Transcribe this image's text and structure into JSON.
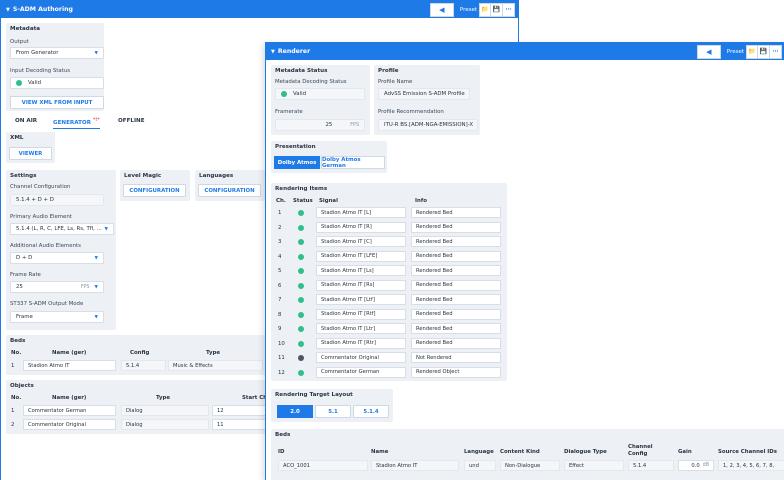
{
  "authoring": {
    "title": "S-ADM Authoring",
    "preset_label": "Preset",
    "metadata": {
      "title": "Metadata",
      "output_label": "Output",
      "output_value": "From Generator",
      "input_decoding_label": "Input Decoding Status",
      "input_decoding_value": "Valid",
      "view_xml_button": "VIEW XML FROM INPUT"
    },
    "tabs": [
      {
        "label": "ON AIR"
      },
      {
        "label": "GENERATOR",
        "marker": "*!*"
      },
      {
        "label": "OFFLINE"
      }
    ],
    "xml": {
      "title": "XML",
      "viewer_button": "VIEWER"
    },
    "settings": {
      "title": "Settings",
      "channel_config_label": "Channel Configuration",
      "channel_config_value": "5.1.4 + D + D",
      "primary_audio_label": "Primary Audio Element",
      "primary_audio_value": "5.1.4 (L, R, C, LFE, Ls, Rs, Tfl, ...",
      "additional_audio_label": "Additional Audio Elements",
      "additional_audio_value": "D + D",
      "frame_rate_label": "Frame Rate",
      "frame_rate_value": "25",
      "frame_rate_unit": "FPS",
      "output_mode_label": "ST337 S-ADM Output Mode",
      "output_mode_value": "Frame"
    },
    "level_magic": {
      "title": "Level Magic",
      "button": "CONFIGURATION"
    },
    "languages": {
      "title": "Languages",
      "button": "CONFIGURATION"
    },
    "beds": {
      "title": "Beds",
      "headers": [
        "No.",
        "Name (ger)",
        "Config",
        "Type"
      ],
      "rows": [
        {
          "no": "1",
          "name": "Stadion Atmo IT",
          "config": "5.1.4",
          "type": "Music & Effects"
        }
      ]
    },
    "objects": {
      "title": "Objects",
      "headers": [
        "No.",
        "Name (ger)",
        "Type",
        "Start Ch"
      ],
      "rows": [
        {
          "no": "1",
          "name": "Commentator German",
          "type": "Dialog",
          "start": "12"
        },
        {
          "no": "2",
          "name": "Commentator Original",
          "type": "Dialog",
          "start": "11"
        }
      ]
    }
  },
  "renderer": {
    "title": "Renderer",
    "preset_label": "Preset",
    "metadata_status": {
      "title": "Metadata Status",
      "decoding_label": "Metadata Decoding Status",
      "decoding_value": "Valid",
      "framerate_label": "Framerate",
      "framerate_value": "25",
      "framerate_unit": "FPS"
    },
    "profile": {
      "title": "Profile",
      "name_label": "Profile Name",
      "name_value": "AdvSS Emission S-ADM Profile",
      "recommendation_label": "Profile Recommendation",
      "recommendation_value": "ITU-R BS.[ADM-NGA-EMISSION]-X"
    },
    "presentation": {
      "title": "Presentation",
      "options": [
        "Dolby Atmos",
        "Dolby Atmos German"
      ],
      "selected": "Dolby Atmos"
    },
    "rendering_items": {
      "title": "Rendering Items",
      "headers": [
        "Ch.",
        "Status",
        "Signal",
        "Info"
      ],
      "rows": [
        {
          "ch": "1",
          "status": "green",
          "signal": "Stadion Atmo IT [L]",
          "info": "Rendered Bed"
        },
        {
          "ch": "2",
          "status": "green",
          "signal": "Stadion Atmo IT [R]",
          "info": "Rendered Bed"
        },
        {
          "ch": "3",
          "status": "green",
          "signal": "Stadion Atmo IT [C]",
          "info": "Rendered Bed"
        },
        {
          "ch": "4",
          "status": "green",
          "signal": "Stadion Atmo IT [LFE]",
          "info": "Rendered Bed"
        },
        {
          "ch": "5",
          "status": "green",
          "signal": "Stadion Atmo IT [Ls]",
          "info": "Rendered Bed"
        },
        {
          "ch": "6",
          "status": "green",
          "signal": "Stadion Atmo IT [Rs]",
          "info": "Rendered Bed"
        },
        {
          "ch": "7",
          "status": "green",
          "signal": "Stadion Atmo IT [Ltf]",
          "info": "Rendered Bed"
        },
        {
          "ch": "8",
          "status": "green",
          "signal": "Stadion Atmo IT [Rtf]",
          "info": "Rendered Bed"
        },
        {
          "ch": "9",
          "status": "green",
          "signal": "Stadion Atmo IT [Ltr]",
          "info": "Rendered Bed"
        },
        {
          "ch": "10",
          "status": "green",
          "signal": "Stadion Atmo IT [Rtr]",
          "info": "Rendered Bed"
        },
        {
          "ch": "11",
          "status": "grey",
          "signal": "Commentator Original",
          "info": "Not Rendered"
        },
        {
          "ch": "12",
          "status": "green",
          "signal": "Commentator German",
          "info": "Rendered Object"
        }
      ]
    },
    "target_layout": {
      "title": "Rendering Target Layout",
      "options": [
        "2.0",
        "5.1",
        "5.1.4"
      ],
      "selected": "2.0"
    },
    "beds": {
      "title": "Beds",
      "headers": [
        "ID",
        "Name",
        "Language",
        "Content Kind",
        "Dialogue Type",
        "Channel Config",
        "Gain",
        "Source Channel IDs"
      ],
      "rows": [
        {
          "id": "ACO_1001",
          "name": "Stadion Atmo IT",
          "language": "und",
          "kind": "Non-Dialogue",
          "dtype": "Effect",
          "config": "5.1.4",
          "gain": "0.0",
          "gain_unit": "dB",
          "sources": "1, 2, 3, 4, 5, 6, 7, 8,"
        }
      ]
    }
  },
  "colors": {
    "accent": "#1e7ae6",
    "valid": "#2fbf8a",
    "inactive": "#4c5563",
    "panel": "#edf1f6"
  }
}
